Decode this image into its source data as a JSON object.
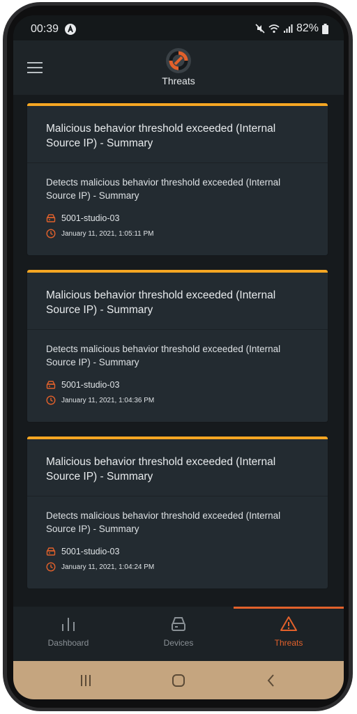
{
  "status_bar": {
    "time": "00:39",
    "battery": "82%"
  },
  "header": {
    "title": "Threats",
    "icons": [
      "menu-icon",
      "app-logo-icon"
    ]
  },
  "threats": [
    {
      "title": "Malicious behavior threshold exceeded (Internal Source IP) - Summary",
      "description": "Detects malicious behavior threshold exceeded (Internal Source IP) - Summary",
      "device": "5001-studio-03",
      "timestamp": "January 11, 2021, 1:05:11 PM"
    },
    {
      "title": "Malicious behavior threshold exceeded (Internal Source IP) - Summary",
      "description": "Detects malicious behavior threshold exceeded (Internal Source IP) - Summary",
      "device": "5001-studio-03",
      "timestamp": "January 11, 2021, 1:04:36 PM"
    },
    {
      "title": "Malicious behavior threshold exceeded (Internal Source IP) - Summary",
      "description": "Detects malicious behavior threshold exceeded (Internal Source IP) - Summary",
      "device": "5001-studio-03",
      "timestamp": "January 11, 2021, 1:04:24 PM"
    }
  ],
  "bottom_nav": {
    "items": [
      {
        "label": "Dashboard",
        "icon": "bar-chart-icon"
      },
      {
        "label": "Devices",
        "icon": "hard-drive-icon"
      },
      {
        "label": "Threats",
        "icon": "warning-triangle-icon"
      }
    ],
    "active": "Threats"
  },
  "colors": {
    "accent": "#e2612b",
    "card_top_border": "#f5a623",
    "system_nav": "#c5a57f"
  }
}
